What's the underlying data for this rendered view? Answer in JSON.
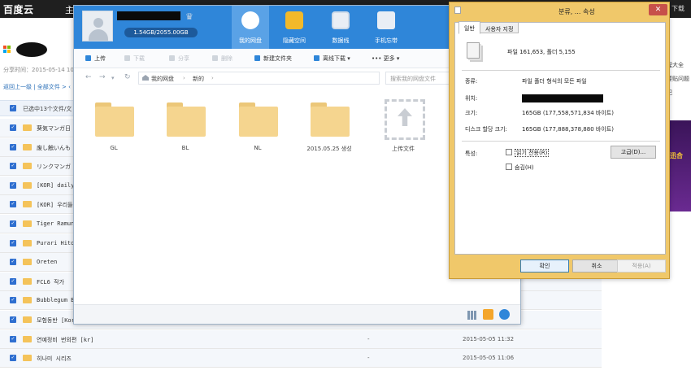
{
  "background_page": {
    "logo": "百度云",
    "logo_sep": "主",
    "top_right_link": "下载",
    "share_time": "分享时间：2015-05-14 10",
    "nav": "返回上一级 | 全部文件 > ‹",
    "selected_text": "已选中13个文件/文",
    "right_panel_lines": [
      "程大全",
      "要贴问题",
      "纪"
    ],
    "banner_text": "迅合",
    "rows": [
      {
        "name": "葵気マンガ日",
        "size": "",
        "date": ""
      },
      {
        "name": "废し触いんも",
        "size": "",
        "date": ""
      },
      {
        "name": "リンクマンガ",
        "size": "",
        "date": ""
      },
      {
        "name": "[KOR] daily",
        "size": "",
        "date": ""
      },
      {
        "name": "[KOR] 우리들",
        "size": "",
        "date": ""
      },
      {
        "name": "Tiger Ramune",
        "size": "",
        "date": ""
      },
      {
        "name": "Purari Hitor",
        "size": "",
        "date": ""
      },
      {
        "name": "Oreten",
        "size": "",
        "date": ""
      },
      {
        "name": "FCL6 작가",
        "size": "",
        "date": ""
      },
      {
        "name": "Bubblegum Be",
        "size": "",
        "date": ""
      },
      {
        "name": "모험동반 [Kor",
        "size": "-",
        "date": "2015-05-05 11:06"
      },
      {
        "name": "연예정비 번외편 [kr]",
        "size": "-",
        "date": "2015-05-05 11:32"
      },
      {
        "name": "히나미 시리즈",
        "size": "-",
        "date": "2015-05-05 11:06"
      }
    ]
  },
  "baidu_client": {
    "quota": "1.54GB/2055.00GB",
    "tabs": [
      {
        "label": "我的网盘"
      },
      {
        "label": "隐藏空间"
      },
      {
        "label": "数据线"
      },
      {
        "label": "手机忘带"
      }
    ],
    "toolbar": {
      "upload": "上传",
      "download": "下载",
      "share": "分享",
      "delete": "删除",
      "new_folder": "新建文件夹",
      "offline": "离线下载 ▾",
      "more": "••• 更多 ▾"
    },
    "path": [
      "我的网盘",
      "新的"
    ],
    "search_placeholder": "搜索我的网盘文件",
    "files": [
      {
        "name": "GL"
      },
      {
        "name": "BL"
      },
      {
        "name": "NL"
      },
      {
        "name": "2015.05.25 생성"
      }
    ],
    "upload_label": "上传文件"
  },
  "properties_dialog": {
    "title": "분류, ... 속성",
    "close_label": "✕",
    "tabs": [
      "일반",
      "사용자 지정"
    ],
    "summary": "파일 161,653, 폴더 5,155",
    "type_label": "종류:",
    "type_value": "파일 폴더 형식의 모든 파일",
    "location_label": "위치:",
    "size_label": "크기:",
    "size_value": "165GB (177,558,571,834 바이트)",
    "size_on_disk_label": "디스크 할당 크기:",
    "size_on_disk_value": "165GB (177,888,378,880 바이트)",
    "attributes_label": "특성:",
    "readonly_label": "읽기 전용(R)",
    "hidden_label": "숨김(H)",
    "advanced_button": "고급(D)...",
    "ok_button": "확인",
    "cancel_button": "취소",
    "apply_button": "적용(A)"
  }
}
